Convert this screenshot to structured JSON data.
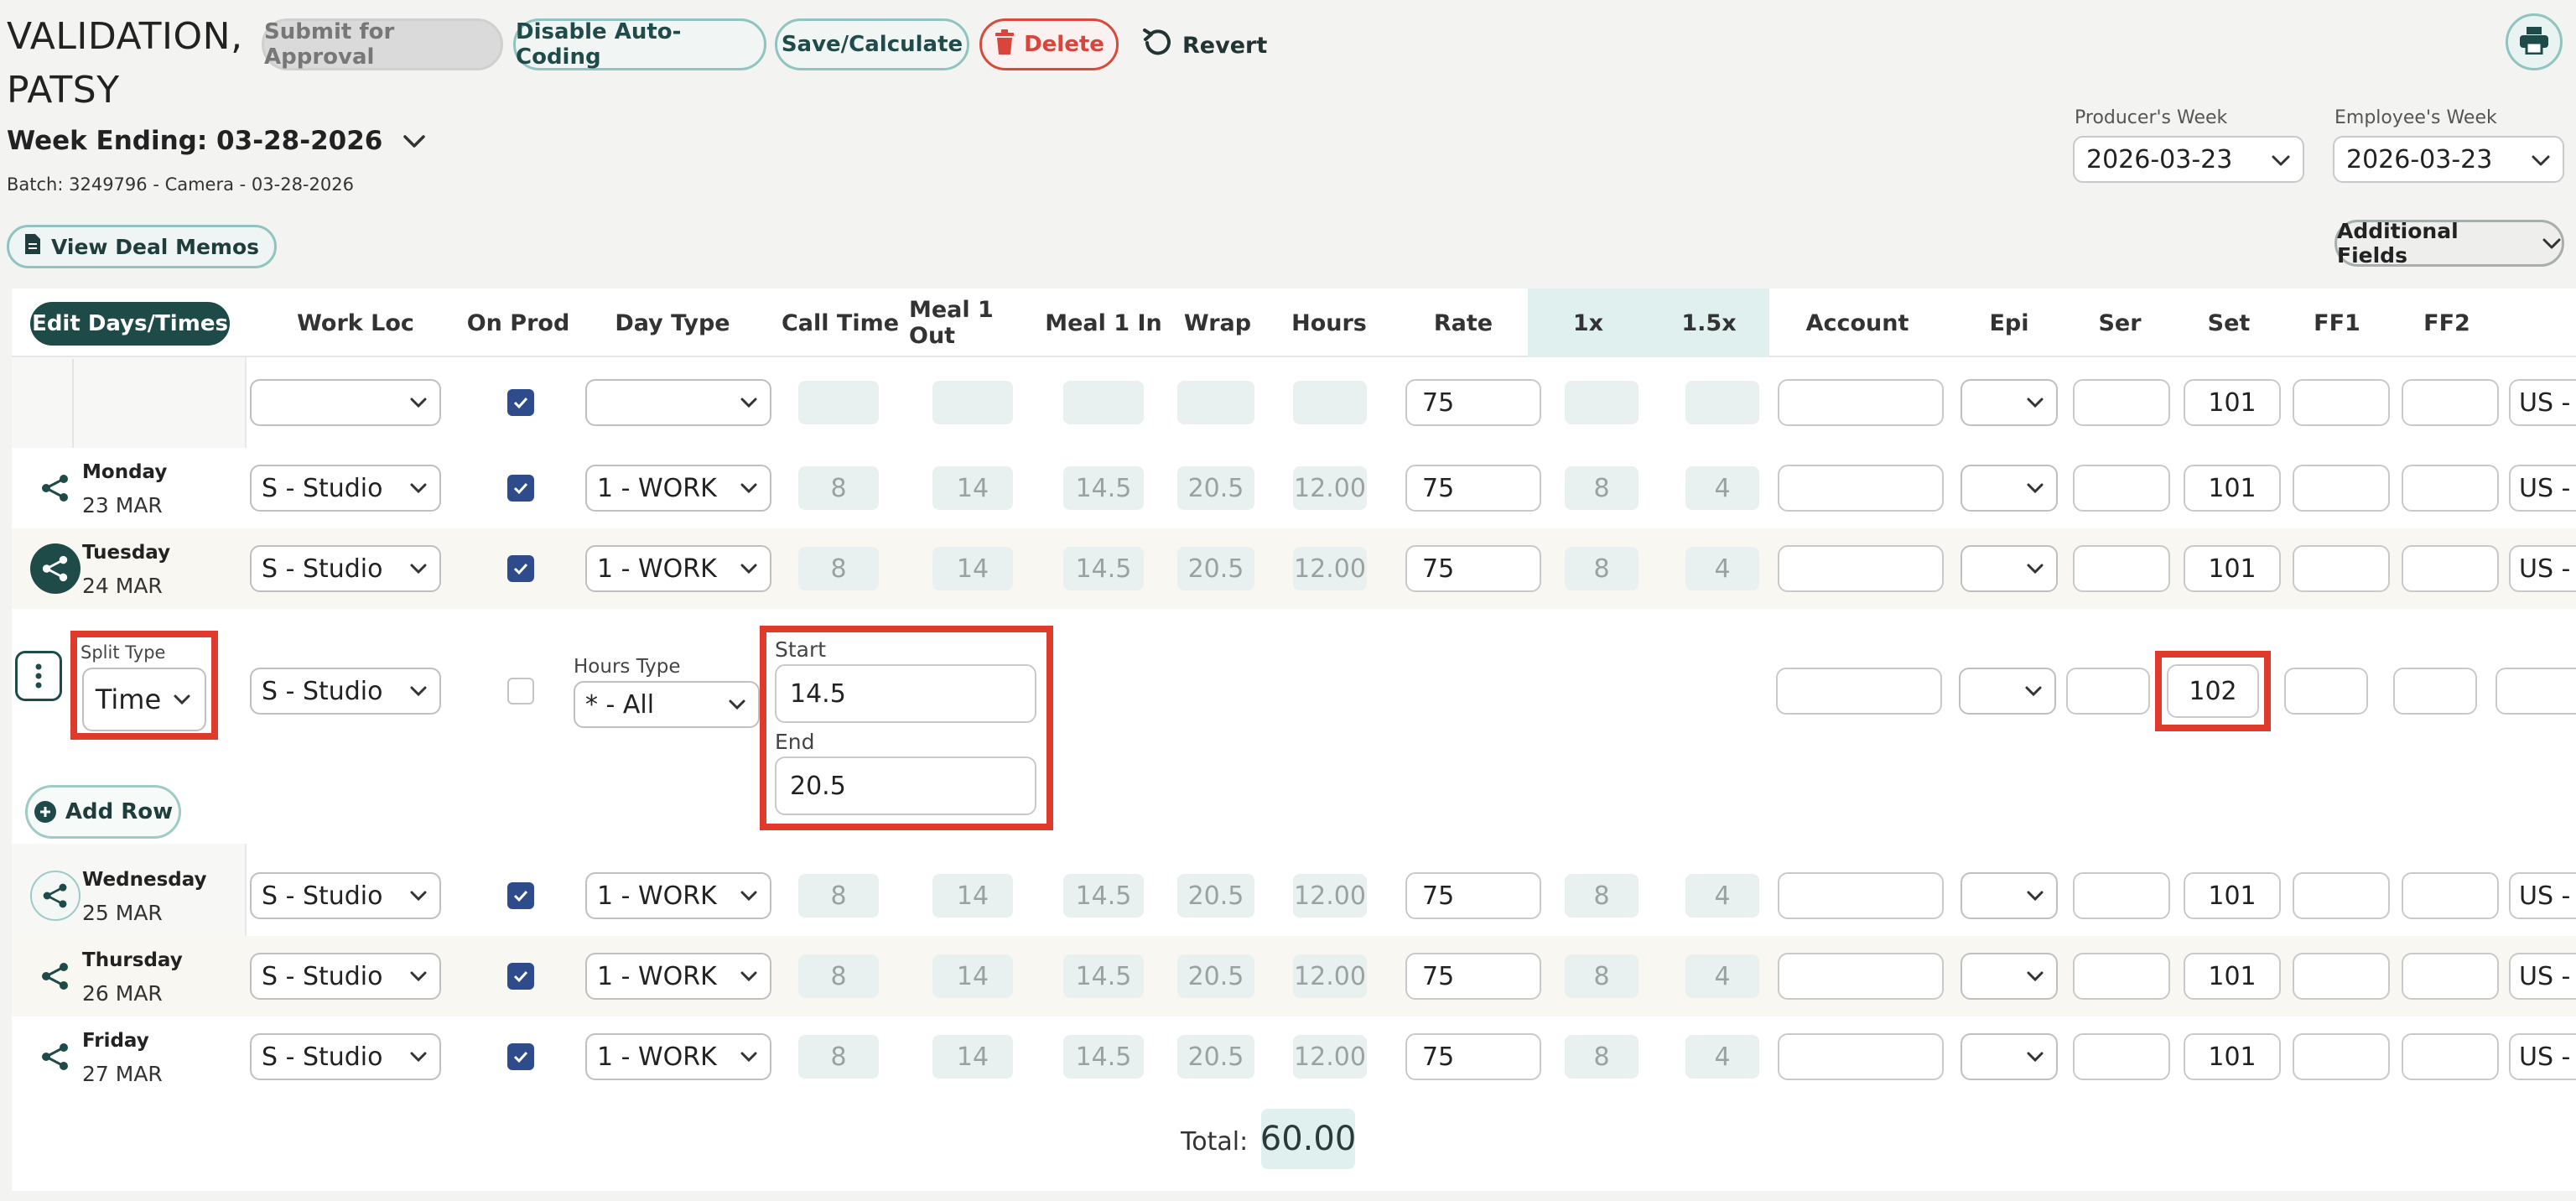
{
  "header": {
    "title_line1": "VALIDATION,",
    "title_line2": "PATSY",
    "week_ending": "Week Ending: 03-28-2026",
    "batch": "Batch: 3249796 - Camera - 03-28-2026",
    "view_deal_memos": "View Deal Memos",
    "additional_fields": "Additional Fields"
  },
  "toolbar": {
    "submit": "Submit for Approval",
    "disable_auto": "Disable Auto-Coding",
    "save": "Save/Calculate",
    "delete": "Delete",
    "revert": "Revert"
  },
  "weeks": {
    "producer_label": "Producer's Week",
    "producer_value": "2026-03-23",
    "employee_label": "Employee's Week",
    "employee_value": "2026-03-23"
  },
  "columns": {
    "edit": "Edit Days/Times",
    "work_loc": "Work Loc",
    "on_prod": "On Prod",
    "day_type": "Day Type",
    "call_time": "Call Time",
    "meal1_out": "Meal 1 Out",
    "meal1_in": "Meal 1 In",
    "wrap": "Wrap",
    "hours": "Hours",
    "rate": "Rate",
    "x1": "1x",
    "x15": "1.5x",
    "account": "Account",
    "epi": "Epi",
    "ser": "Ser",
    "set": "Set",
    "ff1": "FF1",
    "ff2": "FF2"
  },
  "default_row": {
    "rate": "75",
    "set": "101",
    "currency": "US - U"
  },
  "days": [
    {
      "name": "Monday",
      "date": "23 MAR",
      "work_loc": "S - Studio",
      "day_type": "1 - WORK",
      "call": "8",
      "meal_out": "14",
      "meal_in": "14.5",
      "wrap": "20.5",
      "hours": "12.00",
      "rate": "75",
      "x1": "8",
      "x15": "4",
      "set": "101",
      "currency": "US - U"
    },
    {
      "name": "Tuesday",
      "date": "24 MAR",
      "work_loc": "S - Studio",
      "day_type": "1 - WORK",
      "call": "8",
      "meal_out": "14",
      "meal_in": "14.5",
      "wrap": "20.5",
      "hours": "12.00",
      "rate": "75",
      "x1": "8",
      "x15": "4",
      "set": "101",
      "currency": "US - U"
    },
    {
      "name": "Wednesday",
      "date": "25 MAR",
      "work_loc": "S - Studio",
      "day_type": "1 - WORK",
      "call": "8",
      "meal_out": "14",
      "meal_in": "14.5",
      "wrap": "20.5",
      "hours": "12.00",
      "rate": "75",
      "x1": "8",
      "x15": "4",
      "set": "101",
      "currency": "US - U"
    },
    {
      "name": "Thursday",
      "date": "26 MAR",
      "work_loc": "S - Studio",
      "day_type": "1 - WORK",
      "call": "8",
      "meal_out": "14",
      "meal_in": "14.5",
      "wrap": "20.5",
      "hours": "12.00",
      "rate": "75",
      "x1": "8",
      "x15": "4",
      "set": "101",
      "currency": "US - U"
    },
    {
      "name": "Friday",
      "date": "27 MAR",
      "work_loc": "S - Studio",
      "day_type": "1 - WORK",
      "call": "8",
      "meal_out": "14",
      "meal_in": "14.5",
      "wrap": "20.5",
      "hours": "12.00",
      "rate": "75",
      "x1": "8",
      "x15": "4",
      "set": "101",
      "currency": "US - U"
    }
  ],
  "split_row": {
    "split_type_label": "Split Type",
    "split_type_value": "Time",
    "work_loc": "S - Studio",
    "hours_type_label": "Hours Type",
    "hours_type_value": "* - All",
    "start_label": "Start",
    "start_value": "14.5",
    "end_label": "End",
    "end_value": "20.5",
    "set": "102"
  },
  "add_row": "Add Row",
  "total_label": "Total:",
  "total_value": "60.00",
  "colors": {
    "accent_dark": "#1e4a48",
    "accent_border": "#8fc4c0",
    "delete_red": "#d9453a",
    "checkbox_blue": "#2e4b8c",
    "highlight_red": "#e03a2c"
  }
}
